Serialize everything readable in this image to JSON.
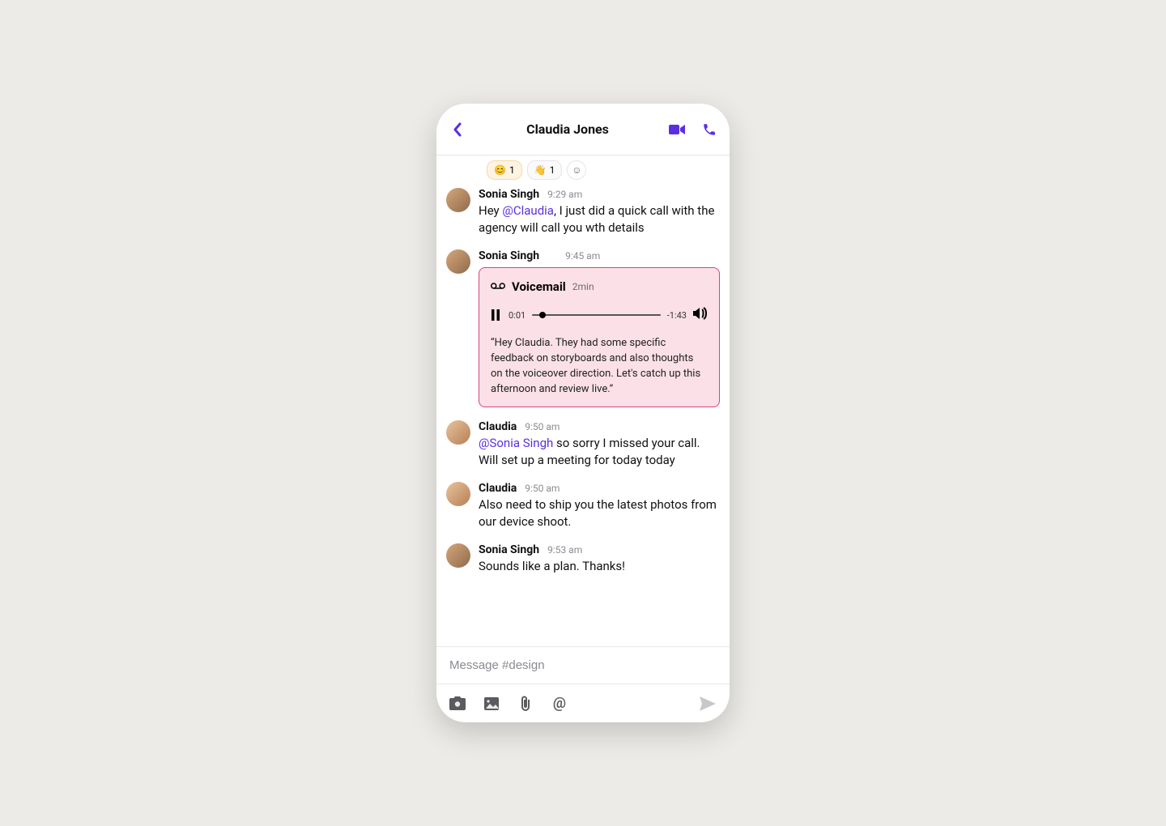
{
  "colors": {
    "accent": "#5b2fe0",
    "vm_border": "#e23d7b",
    "vm_bg": "#fbe1e7"
  },
  "header": {
    "title": "Claudia Jones"
  },
  "reactions": [
    {
      "emoji": "😊",
      "count": "1"
    },
    {
      "emoji": "👋",
      "count": "1"
    }
  ],
  "messages": [
    {
      "id": "m1",
      "author": "Sonia Singh",
      "time": "9:29 am",
      "text_pre": "Hey ",
      "mention": "@Claudia",
      "text_post": ", I just did a quick call with the agency will call you wth details"
    },
    {
      "id": "m2",
      "author": "Sonia Singh",
      "time": "9:45 am",
      "voicemail": {
        "title": "Voicemail",
        "duration": "2min",
        "position": "0:01",
        "remaining": "-1:43",
        "transcript": "“Hey Claudia. They had some specific feedback on storyboards and also thoughts on the voiceover direction. Let's catch up this afternoon and review live.”"
      }
    },
    {
      "id": "m3",
      "author": "Claudia",
      "time": "9:50 am",
      "mention": "@Sonia Singh",
      "text_post": " so sorry I missed your call. Will set up a meeting for today today"
    },
    {
      "id": "m4",
      "author": "Claudia",
      "time": "9:50 am",
      "text": "Also need to ship you the latest photos from our device shoot."
    },
    {
      "id": "m5",
      "author": "Sonia Singh",
      "time": "9:53 am",
      "text": "Sounds like a plan. Thanks!"
    }
  ],
  "composer": {
    "placeholder": "Message #design"
  }
}
